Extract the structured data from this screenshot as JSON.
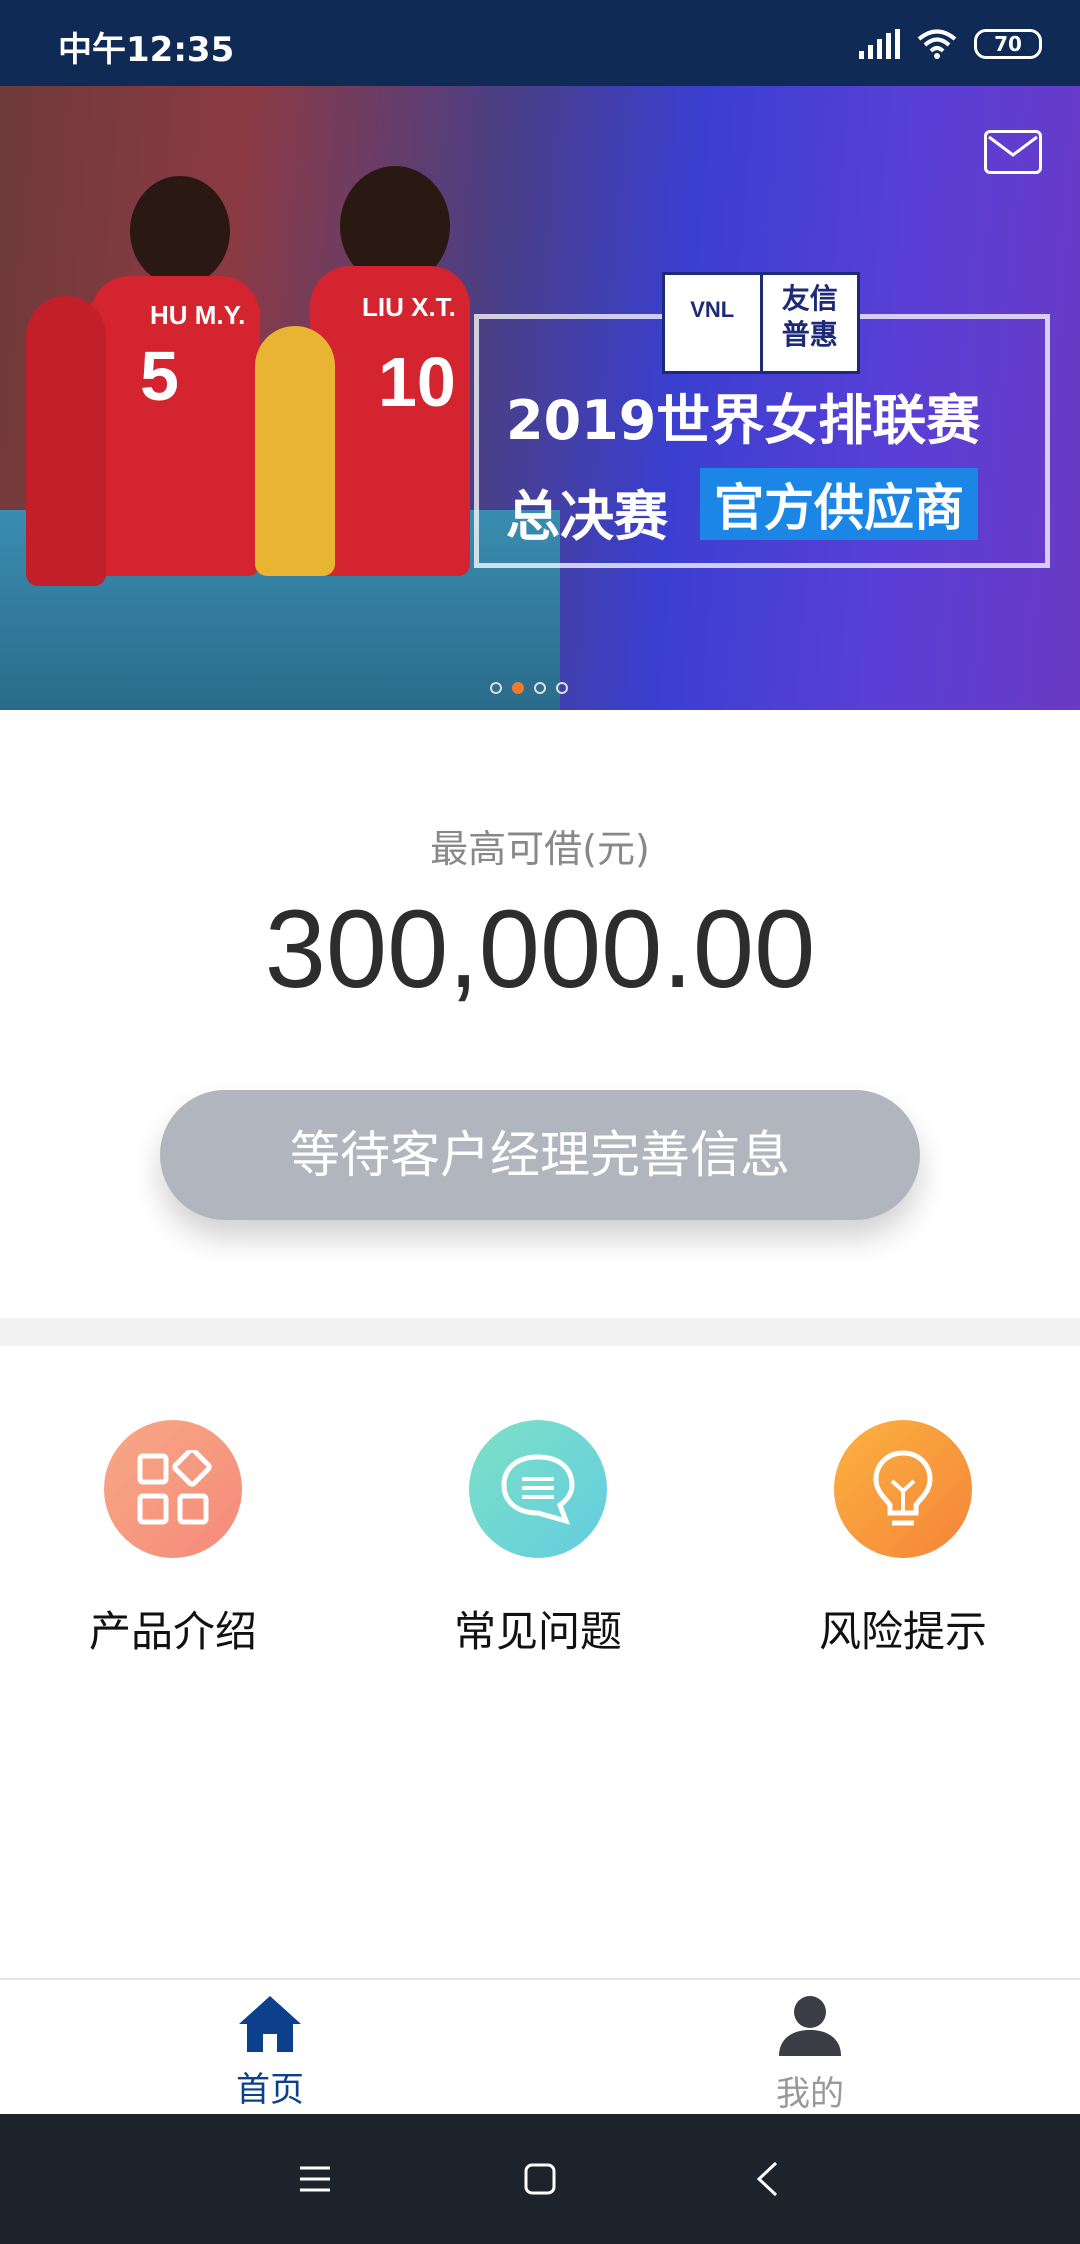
{
  "status": {
    "time": "中午12:35",
    "battery": "70"
  },
  "banner": {
    "jersey_1_name": "HU M.Y.",
    "jersey_1_number": "5",
    "jersey_2_name": "LIU X.T.",
    "jersey_2_number": "10",
    "logo_left": "VNL",
    "logo_right_top": "友信",
    "logo_right_bottom": "普惠",
    "title_line1": "2019世界女排联赛",
    "title_line2": "总决赛",
    "title_line2_highlight": "官方供应商",
    "carousel_active_index": 1
  },
  "loan": {
    "label": "最高可借(元)",
    "amount": "300,000.00",
    "button": "等待客户经理完善信息"
  },
  "features": [
    {
      "label": "产品介绍",
      "icon": "grid-shapes-icon",
      "color": "#f79a7c"
    },
    {
      "label": "常见问题",
      "icon": "chat-bubble-icon",
      "color": "#6fd6d2"
    },
    {
      "label": "风险提示",
      "icon": "lightbulb-icon",
      "color": "#f8973a"
    }
  ],
  "tabs": [
    {
      "label": "首页",
      "icon": "home-icon",
      "active": true
    },
    {
      "label": "我的",
      "icon": "person-icon",
      "active": false
    }
  ],
  "colors": {
    "active_tab": "#0c3f8c",
    "inactive_tab": "#999999",
    "status_bar": "#0e2a55"
  }
}
